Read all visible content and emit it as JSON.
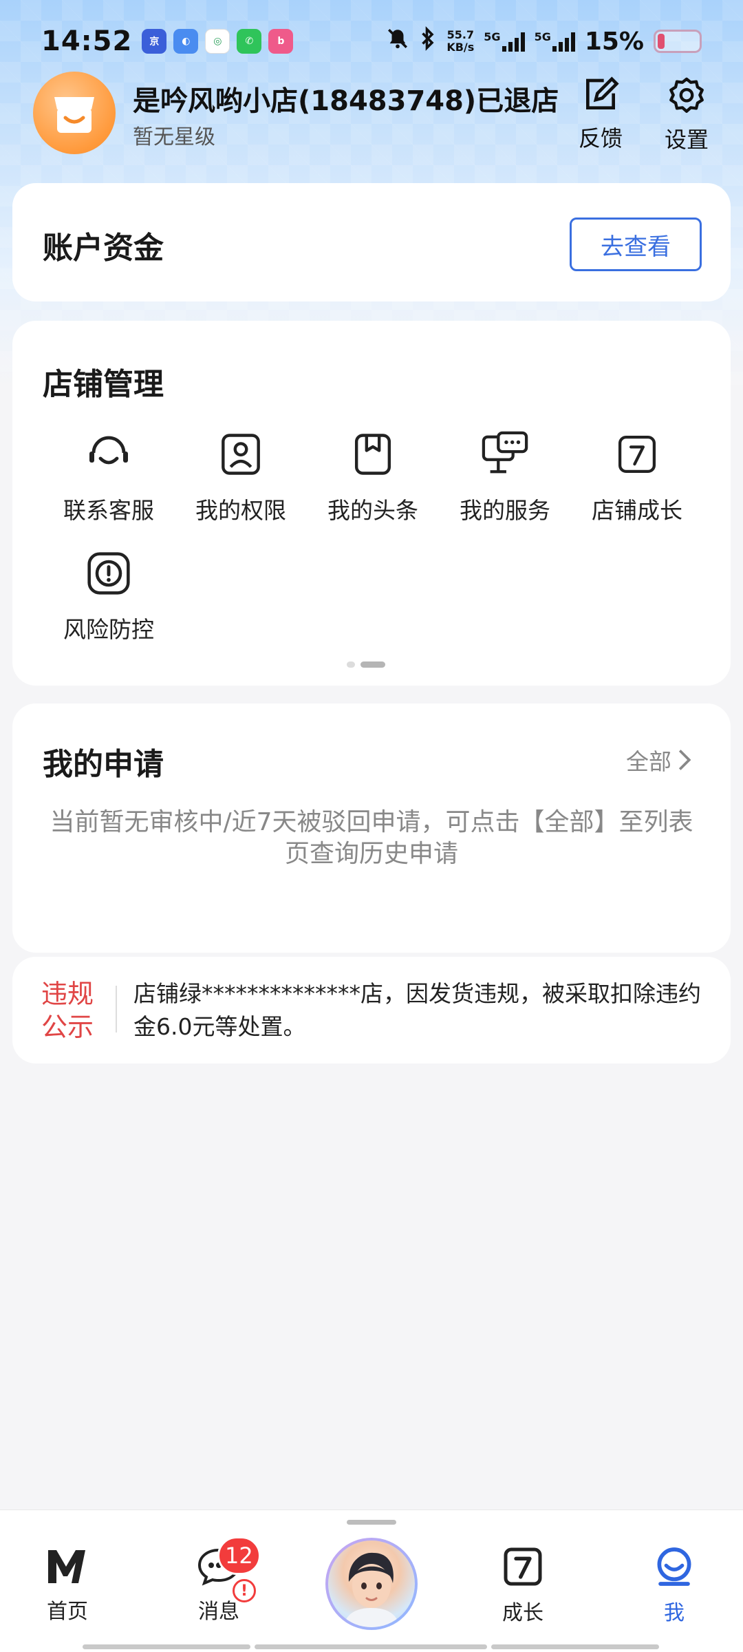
{
  "status_bar": {
    "time": "14:52",
    "network_speed_value": "55.7",
    "network_speed_unit": "KB/s",
    "signal1_label": "5G",
    "signal2_label": "5G",
    "battery_percent": "15%"
  },
  "store": {
    "name": "是吟风哟小店(18483748)已退店",
    "level": "暂无星级",
    "feedback_label": "反馈",
    "settings_label": "设置"
  },
  "account": {
    "title": "账户资金",
    "view_button": "去查看"
  },
  "manage": {
    "title": "店铺管理",
    "tools": [
      {
        "label": "联系客服",
        "icon": "headset-icon"
      },
      {
        "label": "我的权限",
        "icon": "profile-badge-icon"
      },
      {
        "label": "我的头条",
        "icon": "bookmark-icon"
      },
      {
        "label": "我的服务",
        "icon": "monitor-chat-icon"
      },
      {
        "label": "店铺成长",
        "icon": "growth-seven-icon"
      },
      {
        "label": "风险防控",
        "icon": "alert-square-icon"
      }
    ],
    "page_index": 2,
    "page_count": 2
  },
  "applications": {
    "title": "我的申请",
    "all_link": "全部",
    "empty_hint": "当前暂无审核中/近7天被驳回申请，可点击【全部】至列表页查询历史申请"
  },
  "notice": {
    "tag_line1": "违规",
    "tag_line2": "公示",
    "text": "店铺绿**************店，因发货违规，被采取扣除违约金6.0元等处置。"
  },
  "tabbar": {
    "home": "首页",
    "messages": "消息",
    "messages_badge": "12",
    "messages_alert": "!",
    "growth": "成长",
    "me": "我"
  },
  "colors": {
    "accent": "#2f66e0",
    "danger": "#e04545",
    "avatar_orange": "#ff9a3c"
  }
}
